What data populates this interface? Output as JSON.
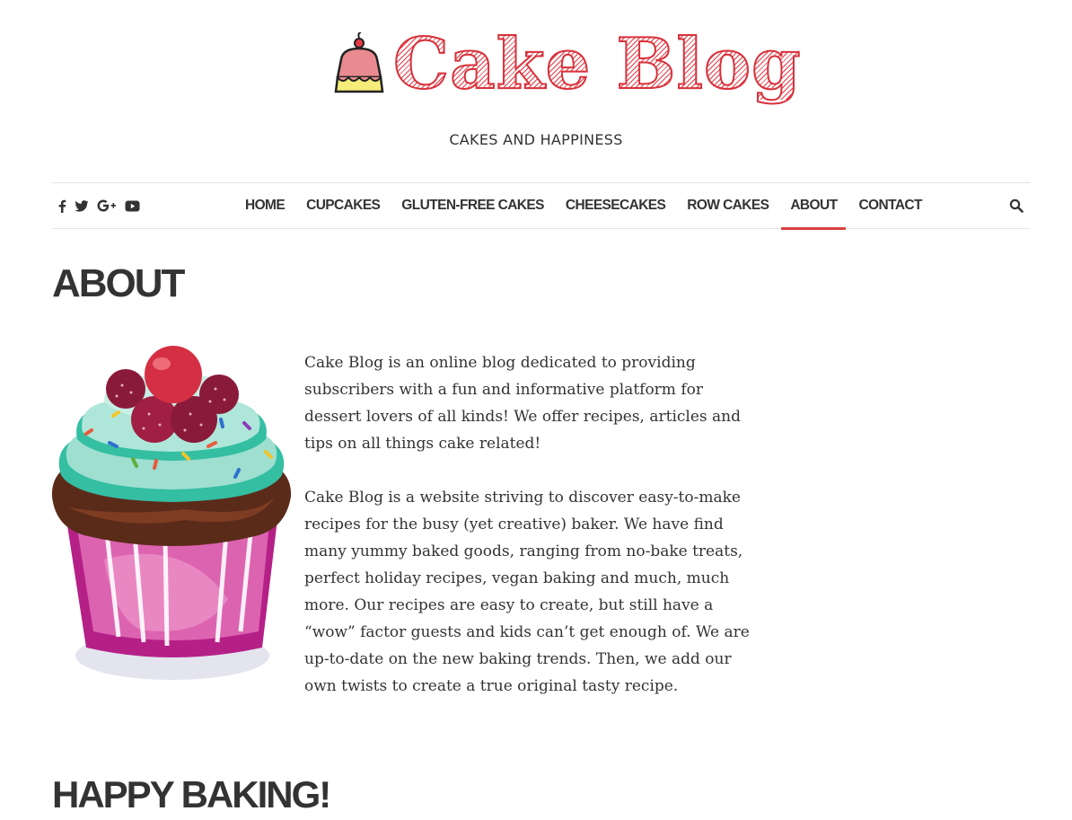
{
  "site": {
    "logo_text": "Cake Blog",
    "tagline": "CAKES AND HAPPINESS"
  },
  "social_icons": [
    "facebook-icon",
    "twitter-icon",
    "google-plus-icon",
    "youtube-icon"
  ],
  "nav": {
    "items": [
      {
        "label": "HOME"
      },
      {
        "label": "CUPCAKES"
      },
      {
        "label": "GLUTEN-FREE CAKES"
      },
      {
        "label": "CHEESECAKES"
      },
      {
        "label": "ROW CAKES"
      },
      {
        "label": "ABOUT",
        "active": true
      },
      {
        "label": "CONTACT"
      }
    ],
    "accent_color": "#d6443e"
  },
  "page": {
    "title": "ABOUT",
    "paragraphs": [
      "Cake Blog is an online blog dedicated to providing subscribers with a fun and informative platform for dessert lovers of all kinds! We offer recipes, articles and tips on all things cake related!",
      "Cake Blog is a website striving to discover easy-to-make recipes for the busy (yet creative) baker. We have find many yummy baked goods, ranging from no-bake treats, perfect holiday recipes, vegan baking and much, much more. Our recipes are easy to create, but still have a “wow” factor guests and kids can’t get enough of. We are up-to-date on the new baking trends. Then, we add our own twists to create a true original tasty recipe."
    ],
    "subheading": "HAPPY BAKING!"
  }
}
